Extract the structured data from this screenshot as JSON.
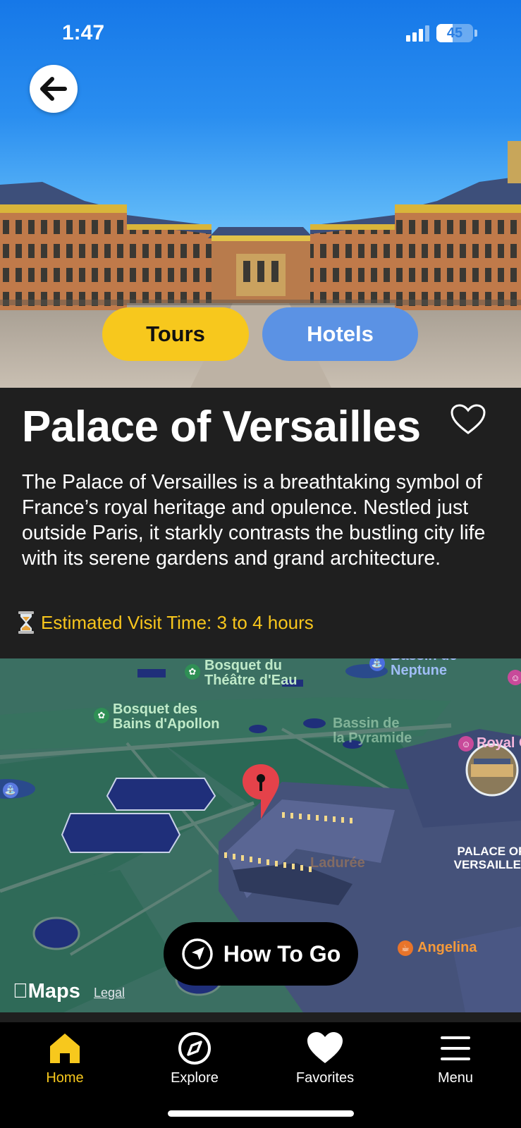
{
  "status_bar": {
    "time": "1:47",
    "battery": "45",
    "battery_level": 0.45
  },
  "hero": {
    "back_icon": "arrow-left-icon",
    "buttons": {
      "tours": "Tours",
      "hotels": "Hotels"
    },
    "colors": {
      "tours": "#f7c81d",
      "hotels": "#5b92e4"
    }
  },
  "place": {
    "title": "Palace of Versailles",
    "favorite_icon": "heart-outline-icon",
    "description": "The Palace of Versailles is a breathtaking symbol of France’s royal heritage and opulence. Nestled just outside Paris, it starkly contrasts the bustling city life with its serene gardens and grand architecture.",
    "visit_icon": "hourglass-icon",
    "visit_time": "Estimated Visit Time: 3 to 4 hours"
  },
  "map": {
    "labels": {
      "bosquet_theatre": "Bosquet du\nThéâtre d'Eau",
      "bassin_neptune": "Bassin de\nNeptune",
      "bosquet_apollon": "Bosquet des\nBains d'Apollon",
      "bassin_pyramide": "Bassin de\nla Pyramide",
      "royal": "Royal C",
      "palace": "PALACE OF\nVERSAILLES",
      "angelina": "Angelina",
      "ladurée": "Ladurée"
    },
    "how_to_go": "How To Go",
    "maps_brand": "Maps",
    "legal": "Legal"
  },
  "tabbar": {
    "items": [
      {
        "label": "Home",
        "icon": "home-icon",
        "active": true
      },
      {
        "label": "Explore",
        "icon": "compass-icon",
        "active": false
      },
      {
        "label": "Favorites",
        "icon": "heart-icon",
        "active": false
      },
      {
        "label": "Menu",
        "icon": "hamburger-menu-icon",
        "active": false
      }
    ],
    "active_color": "#f7c81d"
  }
}
